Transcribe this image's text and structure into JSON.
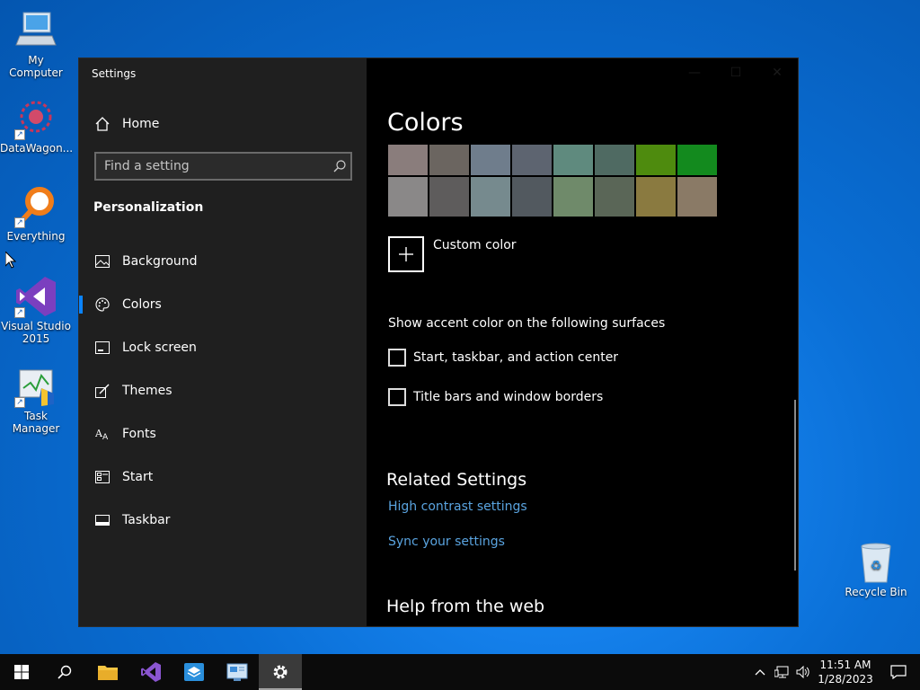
{
  "desktop": {
    "icons": [
      {
        "label": "My Computer",
        "icon": "computer-icon"
      },
      {
        "label": "DataWagon...",
        "icon": "datawagon-icon"
      },
      {
        "label": "Everything",
        "icon": "everything-search-icon"
      },
      {
        "label": "Visual Studio 2015",
        "icon": "visual-studio-icon"
      },
      {
        "label": "Task Manager",
        "icon": "task-manager-icon"
      },
      {
        "label": "Recycle Bin",
        "icon": "recycle-bin-icon"
      }
    ]
  },
  "window": {
    "title": "Settings",
    "sidebar": {
      "home": "Home",
      "search_placeholder": "Find a setting",
      "section": "Personalization",
      "items": [
        {
          "label": "Background",
          "icon": "image-icon"
        },
        {
          "label": "Colors",
          "icon": "palette-icon"
        },
        {
          "label": "Lock screen",
          "icon": "lock-screen-icon"
        },
        {
          "label": "Themes",
          "icon": "themes-brush-icon"
        },
        {
          "label": "Fonts",
          "icon": "fonts-icon"
        },
        {
          "label": "Start",
          "icon": "start-icon"
        },
        {
          "label": "Taskbar",
          "icon": "taskbar-icon"
        }
      ],
      "active_item": "Colors"
    },
    "content": {
      "title": "Colors",
      "swatches_row1": [
        "#8a7d7c",
        "#6b6560",
        "#6f7d8c",
        "#5d6470",
        "#5f8a7e",
        "#4f6a62",
        "#4e8b0e",
        "#138a1e"
      ],
      "swatches_row2": [
        "#8a8888",
        "#5e5c5c",
        "#768a8e",
        "#52595f",
        "#6f8a6a",
        "#5a6657",
        "#8a7a40",
        "#8a7a66"
      ],
      "custom_color": "Custom color",
      "surfaces_label": "Show accent color on the following surfaces",
      "checkboxes": [
        {
          "label": "Start, taskbar, and action center",
          "checked": false
        },
        {
          "label": "Title bars and window borders",
          "checked": false
        }
      ],
      "related_heading": "Related Settings",
      "links": [
        "High contrast settings",
        "Sync your settings"
      ],
      "help_heading": "Help from the web"
    }
  },
  "taskbar": {
    "clock_time": "11:51 AM",
    "clock_date": "1/28/2023"
  },
  "colors": {
    "accent": "#0a84ff",
    "link": "#5aa4e0",
    "sidebar_bg": "#1f1f1f",
    "content_bg": "#000000"
  }
}
